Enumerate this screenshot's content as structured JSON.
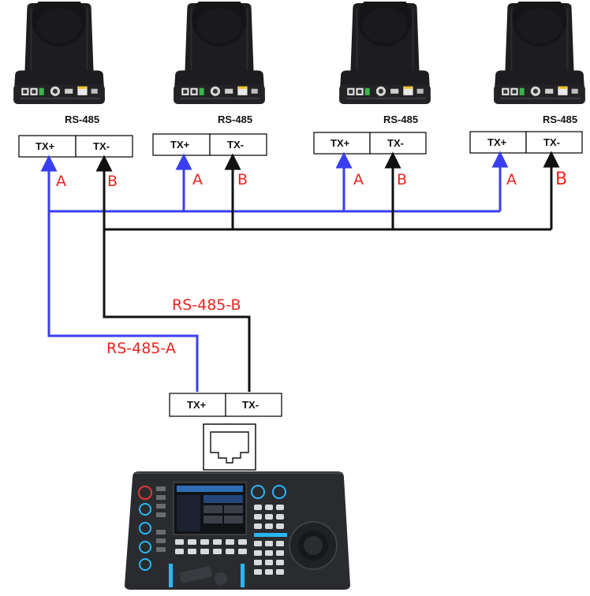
{
  "colors": {
    "wire_a": "#3a3ef2",
    "wire_b": "#111111",
    "label_red": "#e8231f",
    "camera_body": "#1d1d1f"
  },
  "cameras": [
    {
      "port_label": "RS-485",
      "pos_label": "TX+",
      "neg_label": "TX-",
      "a_label": "A",
      "b_label": "B"
    },
    {
      "port_label": "RS-485",
      "pos_label": "TX+",
      "neg_label": "TX-",
      "a_label": "A",
      "b_label": "B"
    },
    {
      "port_label": "RS-485",
      "pos_label": "TX+",
      "neg_label": "TX-",
      "a_label": "A",
      "b_label": "B"
    },
    {
      "port_label": "RS-485",
      "pos_label": "TX+",
      "neg_label": "TX-",
      "a_label": "A",
      "b_label": "B"
    }
  ],
  "bus": {
    "line_b_label": "RS-485-B",
    "line_a_label": "RS-485-A"
  },
  "controller": {
    "pos_label": "TX+",
    "neg_label": "TX-",
    "connector_icon": "rj45-port-icon",
    "device_icon": "ptz-keyboard-controller-icon"
  }
}
